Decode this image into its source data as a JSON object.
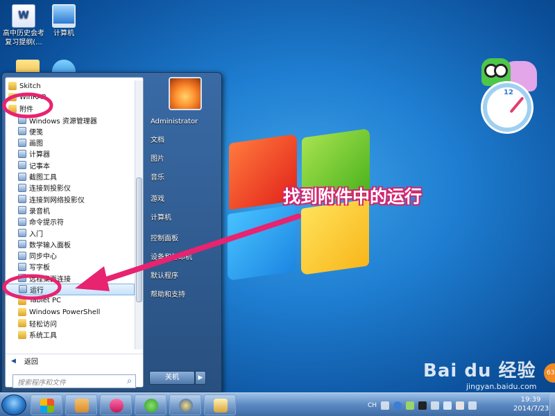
{
  "desktop": {
    "icons": [
      {
        "label": "高中历史会考复习提纲(...",
        "icon": "word-document-icon"
      },
      {
        "label": "计算机",
        "icon": "computer-icon"
      },
      {
        "label": "",
        "icon": "folder-icon"
      },
      {
        "label": "",
        "icon": "ie-icon"
      }
    ]
  },
  "widget": {
    "clock_number": "12"
  },
  "start_menu": {
    "programs": [
      {
        "label": "Skitch",
        "kind": "folder",
        "child": false
      },
      {
        "label": "WinRAR",
        "kind": "folder",
        "child": false
      },
      {
        "label": "附件",
        "kind": "folder",
        "child": false
      },
      {
        "label": "Windows 资源管理器",
        "kind": "app",
        "child": true
      },
      {
        "label": "便笺",
        "kind": "app",
        "child": true
      },
      {
        "label": "画图",
        "kind": "app",
        "child": true
      },
      {
        "label": "计算器",
        "kind": "app",
        "child": true
      },
      {
        "label": "记事本",
        "kind": "app",
        "child": true
      },
      {
        "label": "截图工具",
        "kind": "app",
        "child": true
      },
      {
        "label": "连接到投影仪",
        "kind": "app",
        "child": true
      },
      {
        "label": "连接到网络投影仪",
        "kind": "app",
        "child": true
      },
      {
        "label": "录音机",
        "kind": "app",
        "child": true
      },
      {
        "label": "命令提示符",
        "kind": "app",
        "child": true
      },
      {
        "label": "入门",
        "kind": "app",
        "child": true
      },
      {
        "label": "数学输入面板",
        "kind": "app",
        "child": true
      },
      {
        "label": "同步中心",
        "kind": "app",
        "child": true
      },
      {
        "label": "写字板",
        "kind": "app",
        "child": true
      },
      {
        "label": "远程桌面连接",
        "kind": "app",
        "child": true
      },
      {
        "label": "运行",
        "kind": "app",
        "child": true,
        "highlight": true
      },
      {
        "label": "Tablet PC",
        "kind": "folder",
        "child": true
      },
      {
        "label": "Windows PowerShell",
        "kind": "folder",
        "child": true
      },
      {
        "label": "轻松访问",
        "kind": "folder",
        "child": true
      },
      {
        "label": "系统工具",
        "kind": "folder",
        "child": true
      }
    ],
    "back_label": "返回",
    "search_placeholder": "搜索程序和文件",
    "right_items": [
      {
        "label": "Administrator"
      },
      {
        "label": "文档"
      },
      {
        "label": "图片"
      },
      {
        "label": "音乐"
      },
      {
        "label": "游戏"
      },
      {
        "label": "计算机"
      },
      {
        "label": "控制面板"
      },
      {
        "label": "设备和打印机"
      },
      {
        "label": "默认程序"
      },
      {
        "label": "帮助和支持"
      }
    ],
    "shutdown_label": "关机"
  },
  "annotation": {
    "text": "找到附件中的运行",
    "color": "#d6246e"
  },
  "watermark": {
    "logo": "Bai du 经验",
    "url": "jingyan.baidu.com",
    "badge": "63"
  },
  "taskbar": {
    "pinned": [
      {
        "icon": "windows-icon"
      },
      {
        "icon": "contacts-icon"
      },
      {
        "icon": "heart-icon"
      },
      {
        "icon": "ie-icon"
      },
      {
        "icon": "media-player-icon"
      },
      {
        "icon": "explorer-icon"
      }
    ],
    "tray_text": "CH",
    "time": "19:39",
    "date": "2014/7/23"
  }
}
